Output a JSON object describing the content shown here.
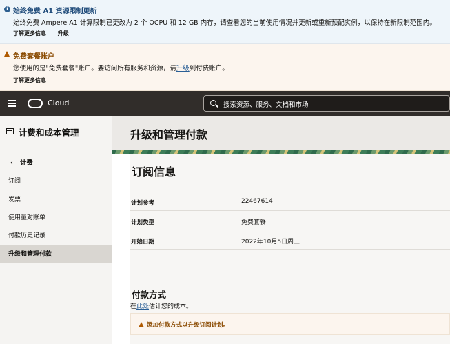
{
  "banners": {
    "info": {
      "title": "始终免费 A1 资源限制更新",
      "message": "始终免费 Ampere A1 计算限制已更改为 2 个 OCPU 和 12 GB 内存，请查看您的当前使用情况并更新或重新预配实例，以保持在新限制范围内。",
      "link_more": "了解更多信息",
      "link_upgrade": "升级"
    },
    "warning": {
      "title": "免费套餐账户",
      "message_before": "您使用的是\"免费套餐\"账户。要访问所有服务和资源，请",
      "message_link": "升级",
      "message_after": "到付费账户。",
      "link_more": "了解更多信息"
    }
  },
  "navbar": {
    "brand": "Cloud",
    "search_placeholder": "搜索资源、服务、文档和市场"
  },
  "sidebar": {
    "title": "计费和成本管理",
    "back_label": "计费",
    "items": [
      {
        "label": "订阅"
      },
      {
        "label": "发票"
      },
      {
        "label": "使用量对账单"
      },
      {
        "label": "付款历史记录"
      },
      {
        "label": "升级和管理付款"
      }
    ],
    "active_index": 4
  },
  "main": {
    "page_title": "升级和管理付款",
    "subscription": {
      "title": "订阅信息",
      "rows": [
        {
          "key": "计划参考",
          "value": "22467614"
        },
        {
          "key": "计划类型",
          "value": "免费套餐"
        },
        {
          "key": "开始日期",
          "value": "2022年10月5日周三"
        }
      ]
    },
    "payment": {
      "title": "付款方式",
      "desc_before": "在",
      "desc_link": "此处",
      "desc_after": "估计您的成本。",
      "warning": "添加付款方式以升级订阅计划。"
    }
  },
  "colors": {
    "navbar_bg": "#312d2a",
    "info_bg": "#eef5fa",
    "warning_bg": "#fcf5ee",
    "link": "#2a5f96",
    "warning_accent": "#b05a00"
  },
  "icons": [
    "info-icon",
    "warning-icon",
    "hamburger-menu-icon",
    "oracle-logo-icon",
    "search-icon",
    "billing-icon",
    "chevron-left-icon"
  ]
}
